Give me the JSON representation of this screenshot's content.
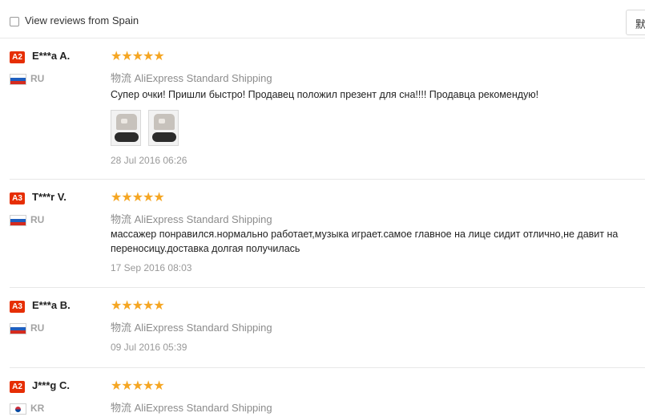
{
  "filter": {
    "checkbox_checked": false,
    "label": "View reviews from Spain",
    "sort_select_visible_text": "默"
  },
  "shipping_prefix": "物流",
  "shipping_method": "AliExpress Standard Shipping",
  "reviews": [
    {
      "level": "A2",
      "name": "E***a A.",
      "country": "RU",
      "flag": "ru-flag-icon",
      "stars": 5,
      "stars_text": "★★★★★",
      "feedback": "Супер очки! Пришли быстро! Продавец положил презент для сна!!!! Продавца рекомендую!",
      "photo_count": 2,
      "date": "28 Jul 2016 06:26"
    },
    {
      "level": "A3",
      "name": "T***r V.",
      "country": "RU",
      "flag": "ru-flag-icon",
      "stars": 5,
      "stars_text": "★★★★★",
      "feedback": "массажер понравился.нормально работает,музыка играет.самое главное на лице сидит отлично,не давит на переносицу.доставка долгая получилась",
      "photo_count": 0,
      "date": "17 Sep 2016 08:03"
    },
    {
      "level": "A3",
      "name": "E***a B.",
      "country": "RU",
      "flag": "ru-flag-icon",
      "stars": 5,
      "stars_text": "★★★★★",
      "feedback": "",
      "photo_count": 0,
      "date": "09 Jul 2016 05:39"
    },
    {
      "level": "A2",
      "name": "J***g C.",
      "country": "KR",
      "flag": "kr-flag-icon",
      "stars": 5,
      "stars_text": "★★★★★",
      "feedback": "",
      "photo_count": 0,
      "date": ""
    }
  ],
  "colors": {
    "badge": "#e62e04",
    "star": "#f5a623",
    "muted": "#999999",
    "divider": "#e8e8e8"
  }
}
